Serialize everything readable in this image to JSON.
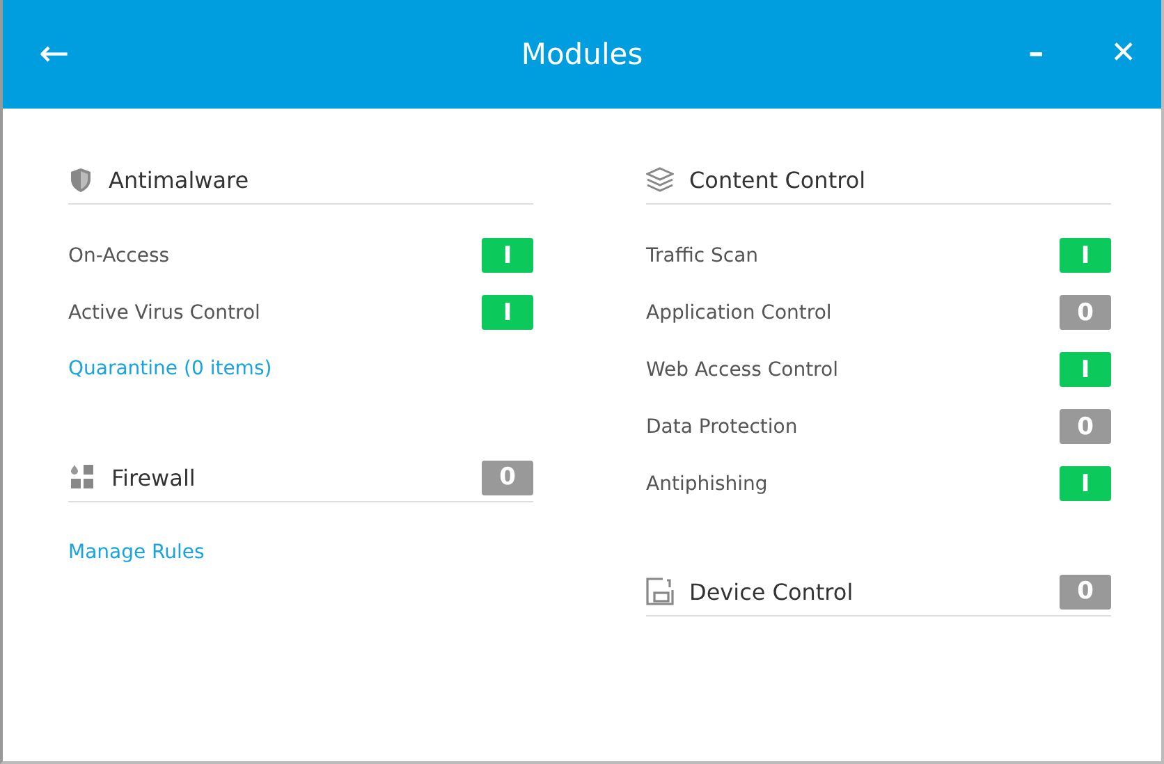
{
  "window": {
    "title": "Modules",
    "back": "←",
    "minimize": "–",
    "close": "✕"
  },
  "columns": [
    {
      "sections": [
        {
          "title": "Antimalware",
          "items": [
            {
              "kind": "toggle",
              "label": "On-Access",
              "on": true,
              "switch_text": "I"
            },
            {
              "kind": "toggle",
              "label": "Active Virus Control",
              "on": true,
              "switch_text": "I"
            },
            {
              "kind": "link",
              "label": "Quarantine (0 items)"
            }
          ]
        },
        {
          "title": "Firewall",
          "switch": {
            "on": false,
            "switch_text": "0"
          },
          "items": [
            {
              "kind": "link",
              "label": "Manage Rules"
            }
          ]
        }
      ]
    },
    {
      "sections": [
        {
          "title": "Content Control",
          "items": [
            {
              "kind": "toggle",
              "label": "Traffic Scan",
              "on": true,
              "switch_text": "I"
            },
            {
              "kind": "toggle",
              "label": "Application Control",
              "on": false,
              "switch_text": "0"
            },
            {
              "kind": "toggle",
              "label": "Web Access Control",
              "on": true,
              "switch_text": "I"
            },
            {
              "kind": "toggle",
              "label": "Data Protection",
              "on": false,
              "switch_text": "0"
            },
            {
              "kind": "toggle",
              "label": "Antiphishing",
              "on": true,
              "switch_text": "I"
            }
          ]
        },
        {
          "title": "Device Control",
          "switch": {
            "on": false,
            "switch_text": "0"
          }
        }
      ]
    }
  ]
}
